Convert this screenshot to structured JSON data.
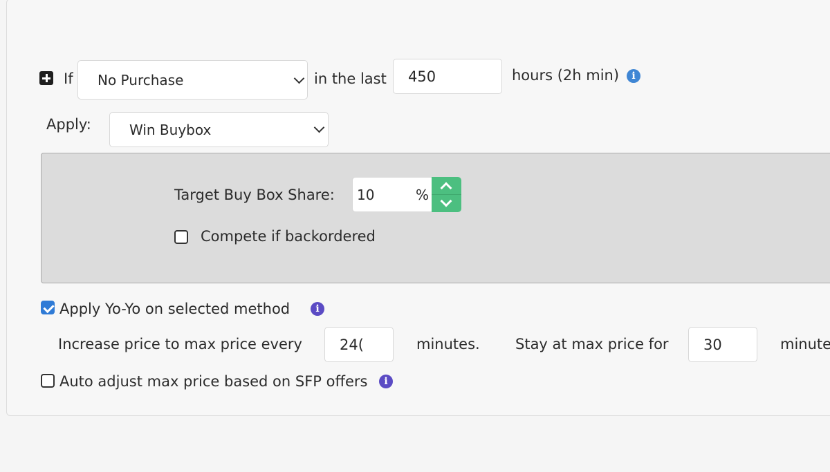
{
  "rule": {
    "if_label": "If",
    "condition_selected": "No Purchase",
    "in_the_last_label": "in the last",
    "hours_value": "450",
    "hours_label": "hours (2h min)"
  },
  "apply": {
    "label": "Apply:",
    "selected": "Win Buybox"
  },
  "buybox": {
    "target_label": "Target Buy Box Share:",
    "target_value": "10",
    "unit": "%",
    "compete_label": "Compete if backordered",
    "compete_checked": false
  },
  "yoyo": {
    "apply_label": "Apply Yo-Yo on selected method",
    "apply_checked": true,
    "increase_label": "Increase price to max price every",
    "increase_value": "24(",
    "minutes_label": "minutes.",
    "stay_label": "Stay at max price for",
    "stay_value": "30",
    "minutes_label_2": "minute"
  },
  "auto_adjust": {
    "label": "Auto adjust max price based on SFP offers",
    "checked": false
  },
  "colors": {
    "info_blue": "#3f86d4",
    "info_purple": "#5b4bc4",
    "spinner_green": "#4cbf80",
    "checkbox_blue": "#2f7bd6"
  },
  "icons": {
    "plus": "plus-square-icon",
    "info": "info-circle-icon",
    "chevron": "chevron-down-icon",
    "spin_up": "chevron-up-icon",
    "spin_down": "chevron-down-icon"
  }
}
